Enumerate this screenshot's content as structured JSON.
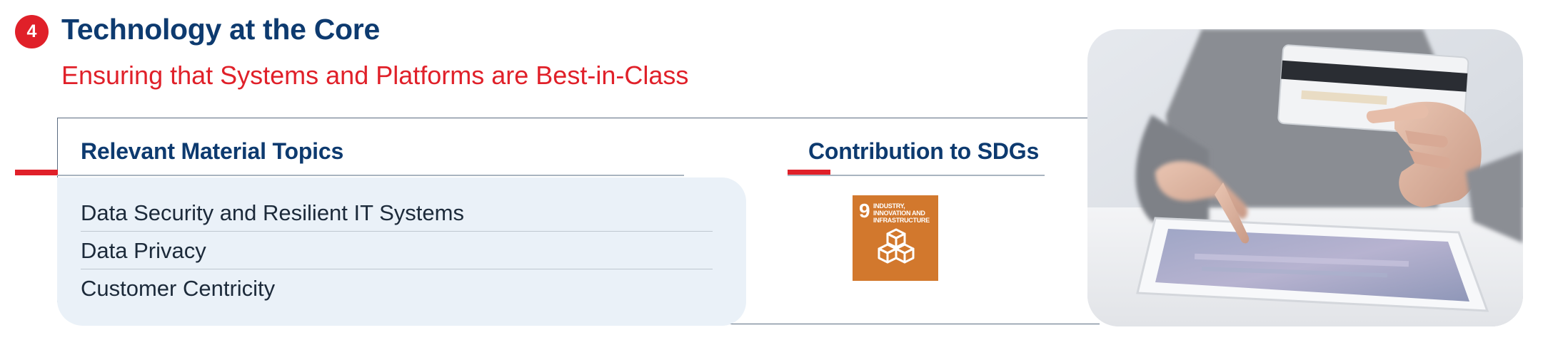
{
  "section": {
    "number": "4",
    "title": "Technology at the Core",
    "subtitle": "Ensuring that Systems and Platforms are Best-in-Class"
  },
  "material_topics": {
    "heading": "Relevant Material Topics",
    "items": [
      "Data Security and Resilient IT Systems",
      "Data Privacy",
      "Customer Centricity"
    ]
  },
  "sdg": {
    "heading": "Contribution to SDGs",
    "tile_number": "9",
    "tile_text": "INDUSTRY, INNOVATION AND INFRASTRUCTURE",
    "tile_icon": "cubes-icon",
    "tile_color": "#d2782d"
  },
  "photo": {
    "subject_icon": "hand-tablet-credit-card-photo"
  },
  "colors": {
    "navy": "#0d3a6f",
    "red": "#e02029",
    "panel": "#eaf1f8"
  }
}
